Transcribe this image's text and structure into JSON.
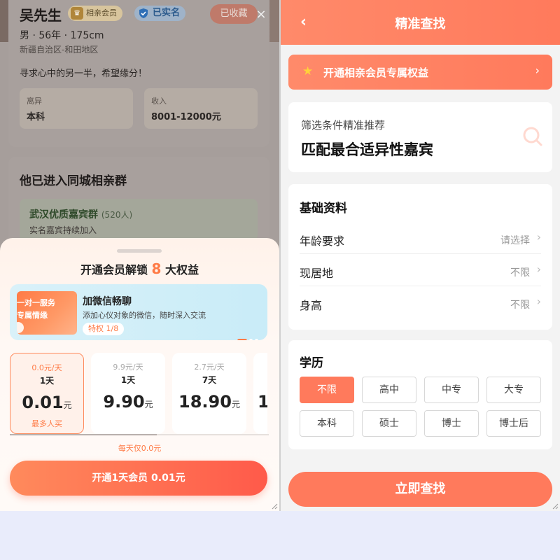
{
  "profile": {
    "name": "吴先生",
    "vip_badge": "相亲会员",
    "verified_badge": "已实名",
    "favorite_label": "已收藏",
    "close_glyph": "×",
    "meta": "男 · 56年 · 175cm",
    "region": "新疆自治区-和田地区",
    "motto": "寻求心中的另一半，希望缘分！",
    "info": [
      {
        "label": "离异",
        "value": "本科"
      },
      {
        "label": "收入",
        "value": "8001-12000元"
      }
    ]
  },
  "group": {
    "title": "他已进入同城相亲群",
    "name": "武汉优质嘉宾群",
    "count": "(520人)",
    "desc": "实名嘉宾持续加入"
  },
  "sheet": {
    "title_prefix": "开通会员解锁",
    "title_num": "8",
    "title_suffix": "大权益",
    "perk": {
      "img_line1": "一对一服务",
      "img_line2": "专属情缘",
      "name": "加微信畅聊",
      "desc": "添加心仪对象的微信，随时深入交流",
      "tag": "特权 1/8"
    },
    "plans": [
      {
        "daily": "0.0元/天",
        "days": "1天",
        "price": "0.01",
        "unit": "元",
        "tag": "最多人买",
        "selected": true
      },
      {
        "daily": "9.9元/天",
        "days": "1天",
        "price": "9.90",
        "unit": "元",
        "tag": "",
        "selected": false
      },
      {
        "daily": "2.7元/天",
        "days": "7天",
        "price": "18.90",
        "unit": "元",
        "tag": "",
        "selected": false
      },
      {
        "daily": "",
        "days": "",
        "price": "1",
        "unit": "",
        "tag": "",
        "selected": false
      }
    ],
    "daily_note": "每天仅0.0元",
    "cta": "开通1天会员 0.01元"
  },
  "search": {
    "title": "精准查找",
    "back_glyph": "‹",
    "vip_bar": "开通相亲会员专属权益",
    "rec_sub": "筛选条件精准推荐",
    "rec_title": "匹配最合适异性嘉宾",
    "basic_title": "基础资料",
    "rows": [
      {
        "label": "年龄要求",
        "value": "请选择"
      },
      {
        "label": "现居地",
        "value": "不限"
      },
      {
        "label": "身高",
        "value": "不限"
      }
    ],
    "edu_title": "学历",
    "edu_options": [
      "不限",
      "高中",
      "中专",
      "大专",
      "本科",
      "硕士",
      "博士",
      "博士后"
    ],
    "edu_selected": "不限",
    "cta": "立即查找"
  },
  "colors": {
    "accent": "#ff7a5c",
    "accent_orange": "#ff7a45",
    "star": "#ffd23a"
  }
}
